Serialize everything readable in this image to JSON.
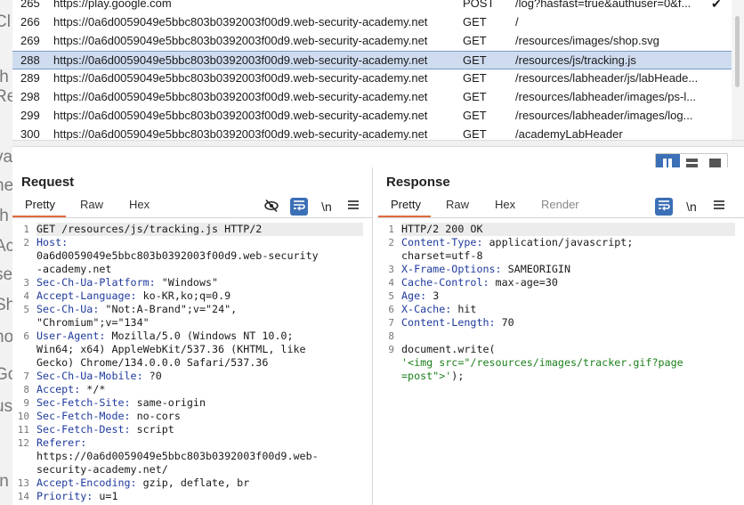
{
  "history": {
    "rows": [
      {
        "num": "265",
        "host": "https://play.google.com",
        "method": "POST",
        "url": "/log?hasfast=true&authuser=0&f...",
        "checked": "✔"
      },
      {
        "num": "266",
        "host": "https://0a6d0059049e5bbc803b0392003f00d9.web-security-academy.net",
        "method": "GET",
        "url": "/",
        "checked": ""
      },
      {
        "num": "269",
        "host": "https://0a6d0059049e5bbc803b0392003f00d9.web-security-academy.net",
        "method": "GET",
        "url": "/resources/images/shop.svg",
        "checked": ""
      },
      {
        "num": "288",
        "host": "https://0a6d0059049e5bbc803b0392003f00d9.web-security-academy.net",
        "method": "GET",
        "url": "/resources/js/tracking.js",
        "checked": ""
      },
      {
        "num": "289",
        "host": "https://0a6d0059049e5bbc803b0392003f00d9.web-security-academy.net",
        "method": "GET",
        "url": "/resources/labheader/js/labHeade...",
        "checked": ""
      },
      {
        "num": "298",
        "host": "https://0a6d0059049e5bbc803b0392003f00d9.web-security-academy.net",
        "method": "GET",
        "url": "/resources/labheader/images/ps-l...",
        "checked": ""
      },
      {
        "num": "299",
        "host": "https://0a6d0059049e5bbc803b0392003f00d9.web-security-academy.net",
        "method": "GET",
        "url": "/resources/labheader/images/log...",
        "checked": ""
      },
      {
        "num": "300",
        "host": "https://0a6d0059049e5bbc803b0392003f00d9.web-security-academy.net",
        "method": "GET",
        "url": "/academyLabHeader",
        "checked": ""
      }
    ],
    "selected_index": 3
  },
  "request": {
    "title": "Request",
    "tabs": [
      "Pretty",
      "Raw",
      "Hex"
    ],
    "active_tab": "Pretty",
    "icons": [
      "eye-off-icon",
      "wrap-icon",
      "newline-icon",
      "menu-icon"
    ],
    "newline_label": "\\n",
    "lines": [
      {
        "num": "1",
        "key": "",
        "text": "GET /resources/js/tracking.js HTTP/2"
      },
      {
        "num": "2",
        "key": "Host:",
        "text": ""
      },
      {
        "num": "",
        "key": "",
        "text": "0a6d0059049e5bbc803b0392003f00d9.web-security"
      },
      {
        "num": "",
        "key": "",
        "text": "-academy.net"
      },
      {
        "num": "3",
        "key": "Sec-Ch-Ua-Platform:",
        "text": " \"Windows\""
      },
      {
        "num": "4",
        "key": "Accept-Language:",
        "text": " ko-KR,ko;q=0.9"
      },
      {
        "num": "5",
        "key": "Sec-Ch-Ua:",
        "text": " \"Not:A-Brand\";v=\"24\","
      },
      {
        "num": "",
        "key": "",
        "text": "\"Chromium\";v=\"134\""
      },
      {
        "num": "6",
        "key": "User-Agent:",
        "text": " Mozilla/5.0 (Windows NT 10.0;"
      },
      {
        "num": "",
        "key": "",
        "text": "Win64; x64) AppleWebKit/537.36 (KHTML, like"
      },
      {
        "num": "",
        "key": "",
        "text": "Gecko) Chrome/134.0.0.0 Safari/537.36"
      },
      {
        "num": "7",
        "key": "Sec-Ch-Ua-Mobile:",
        "text": " ?0"
      },
      {
        "num": "8",
        "key": "Accept:",
        "text": " */*"
      },
      {
        "num": "9",
        "key": "Sec-Fetch-Site:",
        "text": " same-origin"
      },
      {
        "num": "10",
        "key": "Sec-Fetch-Mode:",
        "text": " no-cors"
      },
      {
        "num": "11",
        "key": "Sec-Fetch-Dest:",
        "text": " script"
      },
      {
        "num": "12",
        "key": "Referer:",
        "text": ""
      },
      {
        "num": "",
        "key": "",
        "text": "https://0a6d0059049e5bbc803b0392003f00d9.web-"
      },
      {
        "num": "",
        "key": "",
        "text": "security-academy.net/"
      },
      {
        "num": "13",
        "key": "Accept-Encoding:",
        "text": " gzip, deflate, br"
      },
      {
        "num": "14",
        "key": "Priority:",
        "text": " u=1"
      }
    ]
  },
  "response": {
    "title": "Response",
    "tabs": [
      "Pretty",
      "Raw",
      "Hex",
      "Render"
    ],
    "active_tab": "Pretty",
    "icons": [
      "wrap-icon",
      "newline-icon",
      "menu-icon"
    ],
    "newline_label": "\\n",
    "lines": [
      {
        "num": "1",
        "key": "",
        "text": "HTTP/2 200 OK",
        "style": "plain"
      },
      {
        "num": "2",
        "key": "Content-Type:",
        "text": " application/javascript;",
        "style": "plain"
      },
      {
        "num": "",
        "key": "",
        "text": "charset=utf-8",
        "style": "plain"
      },
      {
        "num": "3",
        "key": "X-Frame-Options:",
        "text": " SAMEORIGIN",
        "style": "plain"
      },
      {
        "num": "4",
        "key": "Cache-Control:",
        "text": " max-age=30",
        "style": "plain"
      },
      {
        "num": "5",
        "key": "Age:",
        "text": " 3",
        "style": "plain"
      },
      {
        "num": "6",
        "key": "X-Cache:",
        "text": " hit",
        "style": "plain"
      },
      {
        "num": "7",
        "key": "Content-Length:",
        "text": " 70",
        "style": "plain"
      },
      {
        "num": "8",
        "key": "",
        "text": "",
        "style": "plain"
      },
      {
        "num": "9",
        "key": "",
        "text": "document.write(",
        "style": "plain"
      },
      {
        "num": "",
        "key": "",
        "text": "'<img src=\"/resources/images/tracker.gif?page",
        "style": "str"
      },
      {
        "num": "",
        "key": "",
        "text": "=post\">'",
        "style": "str",
        "suffix": ");"
      }
    ]
  },
  "colors": {
    "accent": "#3b6fb6",
    "tab_underline": "#e06a3c",
    "header_key": "#1f3a9e",
    "string": "#1a7f1a",
    "selected_row": "#cfdcf0"
  }
}
